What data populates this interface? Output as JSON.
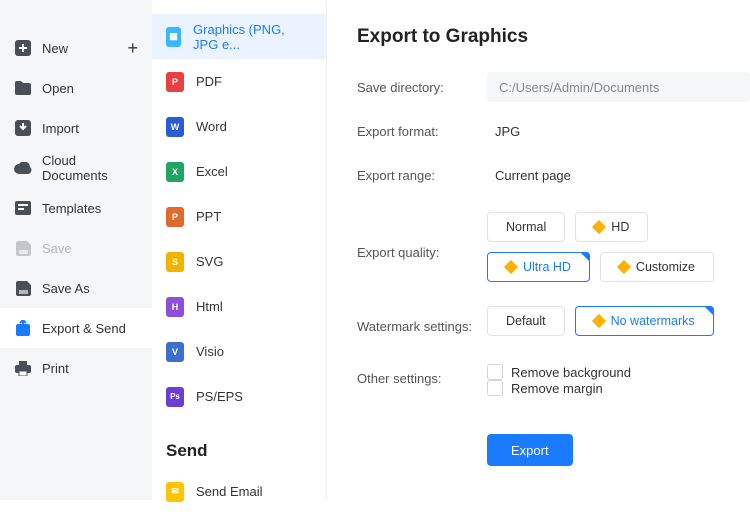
{
  "sidebar": {
    "items": [
      {
        "label": "New",
        "icon": "plus-square",
        "hasPlus": true
      },
      {
        "label": "Open",
        "icon": "folder"
      },
      {
        "label": "Import",
        "icon": "import"
      },
      {
        "label": "Cloud Documents",
        "icon": "cloud"
      },
      {
        "label": "Templates",
        "icon": "templates"
      },
      {
        "label": "Save",
        "icon": "save",
        "disabled": true
      },
      {
        "label": "Save As",
        "icon": "saveas"
      },
      {
        "label": "Export & Send",
        "icon": "export",
        "active": true
      },
      {
        "label": "Print",
        "icon": "print"
      }
    ]
  },
  "formats": {
    "items": [
      {
        "label": "Graphics (PNG, JPG e...",
        "color": "#39b8ff",
        "glyph": "▦",
        "selected": true
      },
      {
        "label": "PDF",
        "color": "#e64040",
        "glyph": "P"
      },
      {
        "label": "Word",
        "color": "#2b5bd7",
        "glyph": "W"
      },
      {
        "label": "Excel",
        "color": "#1fa463",
        "glyph": "X"
      },
      {
        "label": "PPT",
        "color": "#e06a2b",
        "glyph": "P"
      },
      {
        "label": "SVG",
        "color": "#f0b400",
        "glyph": "S"
      },
      {
        "label": "Html",
        "color": "#8b4fd9",
        "glyph": "H"
      },
      {
        "label": "Visio",
        "color": "#3c6ecc",
        "glyph": "V"
      },
      {
        "label": "PS/EPS",
        "color": "#6a3fd1",
        "glyph": "Ps"
      }
    ],
    "sendHeader": "Send",
    "sendItems": [
      {
        "label": "Send Email",
        "color": "#ffc400",
        "glyph": "✉"
      }
    ]
  },
  "panel": {
    "title": "Export to Graphics",
    "saveDirLabel": "Save directory:",
    "saveDirValue": "C:/Users/Admin/Documents",
    "formatLabel": "Export format:",
    "formatValue": "JPG",
    "rangeLabel": "Export range:",
    "rangeValue": "Current page",
    "qualityLabel": "Export quality:",
    "quality": {
      "normal": "Normal",
      "hd": "HD",
      "ultra": "Ultra HD",
      "customize": "Customize"
    },
    "watermarkLabel": "Watermark settings:",
    "watermark": {
      "default": "Default",
      "none": "No watermarks"
    },
    "otherLabel": "Other settings:",
    "other": {
      "removeBg": "Remove background",
      "removeMargin": "Remove margin"
    },
    "exportBtn": "Export"
  }
}
